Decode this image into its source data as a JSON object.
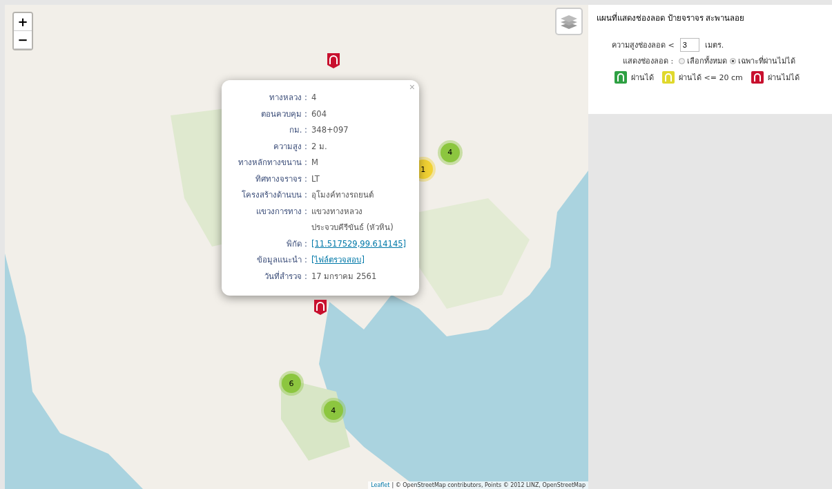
{
  "map": {
    "zoom_in": "+",
    "zoom_out": "−",
    "clusters": [
      {
        "count": "4",
        "color": "#8cc63f"
      },
      {
        "count": "1",
        "color": "#f1d133"
      },
      {
        "count": "6",
        "color": "#8cc63f"
      },
      {
        "count": "4",
        "color": "#8cc63f"
      }
    ],
    "markers": [
      {
        "color": "#c8102e"
      },
      {
        "color": "#c8102e"
      }
    ],
    "attribution": {
      "link": "Leaflet",
      "text": "| © OpenStreetMap contributors, Points © 2012 LINZ, OpenStreetMap"
    },
    "popup": {
      "close": "×",
      "rows": [
        {
          "label": "ทางหลวง :",
          "value": "4",
          "kind": "text"
        },
        {
          "label": "ตอนควบคุม :",
          "value": "604",
          "kind": "text"
        },
        {
          "label": "กม. :",
          "value": "348+097",
          "kind": "text"
        },
        {
          "label": "ความสูง :",
          "value": "2 ม.",
          "kind": "text"
        },
        {
          "label": "ทางหลักทางขนาน :",
          "value": "M",
          "kind": "text"
        },
        {
          "label": "ทิศทางจราจร :",
          "value": "LT",
          "kind": "text"
        },
        {
          "label": "โครงสร้างด้านบน :",
          "value": "อุโมงค์ทางรถยนต์",
          "kind": "text"
        },
        {
          "label": "แขวงการทาง :",
          "value": "แขวงทางหลวงประจวบคีรีขันธ์ (หัวหิน)",
          "kind": "text"
        },
        {
          "label": "พิกัด :",
          "value": "[11.517529,99.614145]",
          "kind": "link"
        },
        {
          "label": "ข้อมูลแนะนำ :",
          "value": "[ไฟล์ตรวจสอบ]",
          "kind": "link"
        },
        {
          "label": "วันที่สำรวจ :",
          "value": "17 มกราคม 2561",
          "kind": "text"
        }
      ]
    }
  },
  "panel": {
    "title": "แผนที่แสดงช่องลอด ป้ายจราจร สะพานลอย",
    "height": {
      "label": "ความสูงช่องลอด <",
      "value": "3",
      "unit": "เมตร."
    },
    "filter": {
      "label": "แสดงช่องลอด :",
      "options": [
        {
          "label": "เลือกทั้งหมด",
          "selected": false
        },
        {
          "label": "เฉพาะที่ผ่านไม่ได้",
          "selected": true
        }
      ]
    },
    "legend": [
      {
        "label": "ผ่านได้",
        "color": "#2ea043"
      },
      {
        "label": "ผ่านได้ <= 20 cm",
        "color": "#e0d82c"
      },
      {
        "label": "ผ่านไม่ได้",
        "color": "#c8102e"
      }
    ]
  }
}
